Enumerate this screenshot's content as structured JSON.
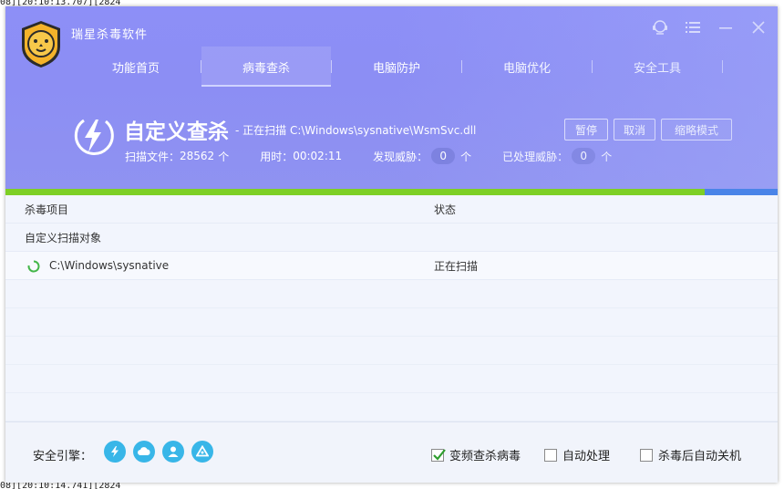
{
  "console": {
    "line1": "08][20:10:13.707][2824",
    "line2": "08][20:10:14.741][2824"
  },
  "app": {
    "title": "瑞星杀毒软件"
  },
  "nav": {
    "tabs": [
      {
        "label": "功能首页",
        "active": false
      },
      {
        "label": "病毒查杀",
        "active": true
      },
      {
        "label": "电脑防护",
        "active": false
      },
      {
        "label": "电脑优化",
        "active": false
      },
      {
        "label": "安全工具",
        "active": false
      }
    ]
  },
  "scan": {
    "title": "自定义查杀",
    "current": "- 正在扫描 C:\\Windows\\sysnative\\WsmSvc.dll",
    "files_label": "扫描文件：",
    "files_value": "28562",
    "files_unit": "个",
    "time_label": "用时：",
    "time_value": "00:02:11",
    "threats_label": "发现威胁：",
    "threats_value": "0",
    "threats_unit": "个",
    "handled_label": "已处理威胁：",
    "handled_value": "0",
    "handled_unit": "个",
    "progress": 0.905
  },
  "buttons": {
    "pause": "暂停",
    "cancel": "取消",
    "compact": "缩略模式"
  },
  "table": {
    "col_item": "杀毒项目",
    "col_status": "状态",
    "group_label": "自定义扫描对象",
    "rows": [
      {
        "path": "C:\\Windows\\sysnative",
        "status": "正在扫描"
      }
    ]
  },
  "footer": {
    "engine_label": "安全引擎：",
    "engines": [
      "lightning-engine-icon",
      "cloud-engine-icon",
      "user-engine-icon",
      "drive-engine-icon"
    ],
    "options": [
      {
        "label": "变频查杀病毒",
        "checked": true
      },
      {
        "label": "自动处理",
        "checked": false
      },
      {
        "label": "杀毒后自动关机",
        "checked": false
      }
    ]
  },
  "colors": {
    "header": "#8d8ff7",
    "progress_fill": "#7ecf25",
    "progress_track": "#4a84e8",
    "engine": "#38b6e8"
  }
}
